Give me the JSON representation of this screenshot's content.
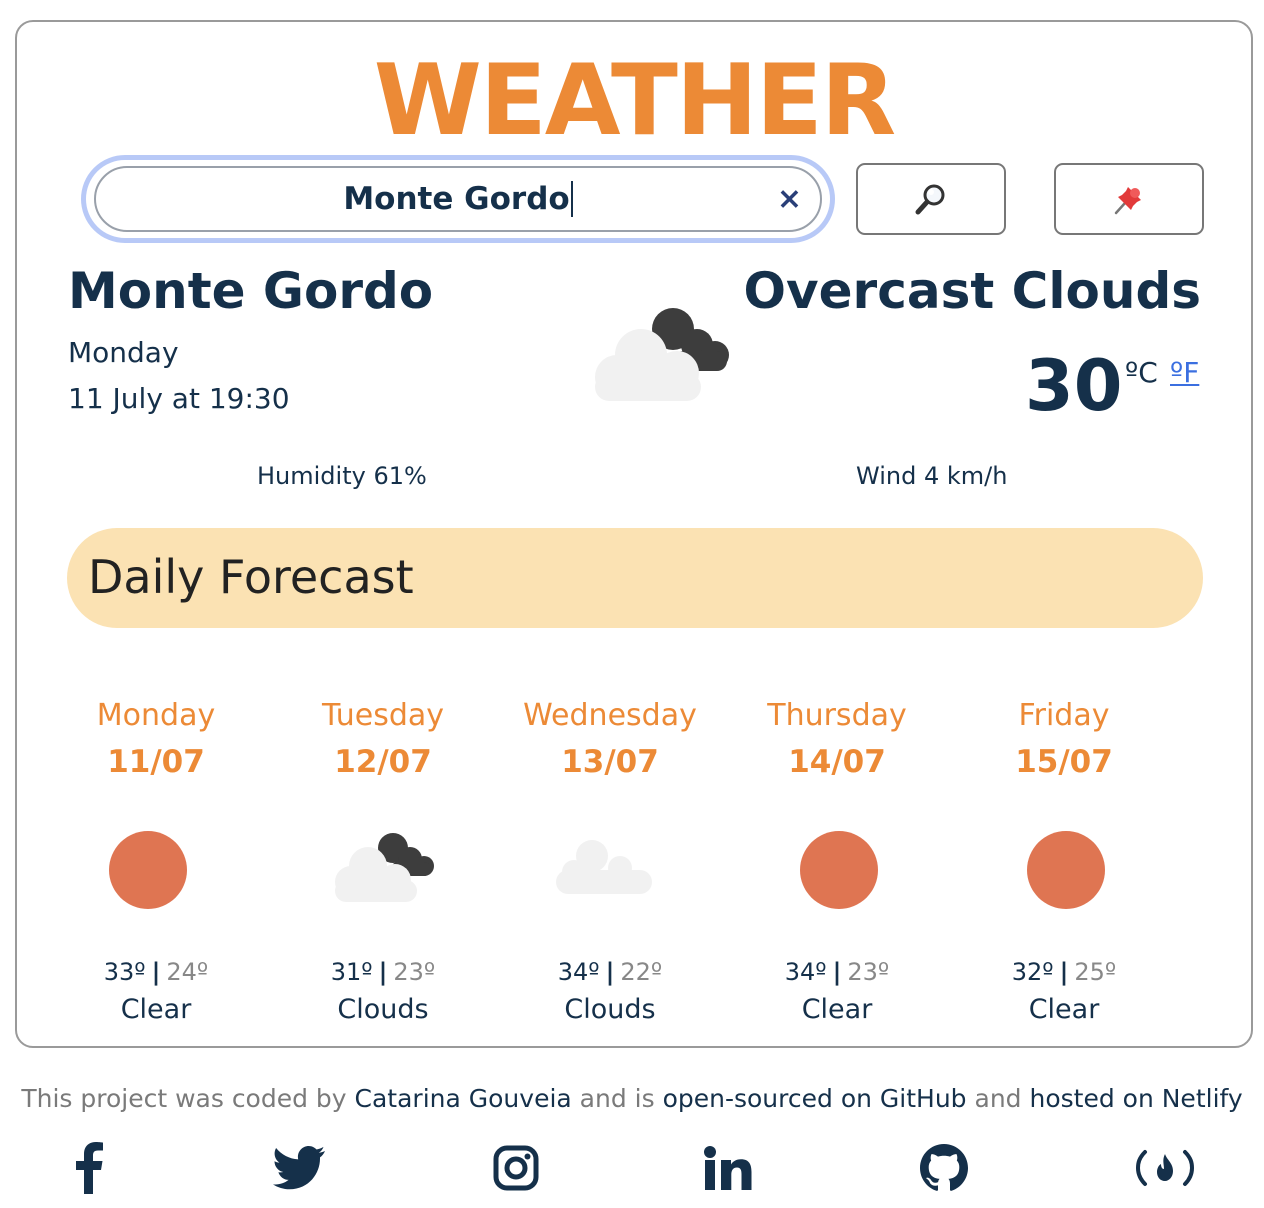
{
  "app": {
    "title": "WEATHER"
  },
  "search": {
    "value": "Monte Gordo",
    "clear_glyph": "×"
  },
  "buttons": {
    "search_icon": "magnifier-icon",
    "location_icon": "pushpin-icon"
  },
  "current": {
    "city": "Monte Gordo",
    "day": "Monday",
    "date": "11 July at 19:30",
    "condition": "Overcast Clouds",
    "temperature": "30",
    "unit_c": "ºC",
    "unit_f": "ºF",
    "humidity": "Humidity 61%",
    "wind": "Wind 4 km/h",
    "icon": "overcast-clouds-icon"
  },
  "forecast": {
    "title": "Daily Forecast",
    "days": [
      {
        "name": "Monday",
        "date": "11/07",
        "max": "33º",
        "min": "24º",
        "desc": "Clear",
        "icon": "sun"
      },
      {
        "name": "Tuesday",
        "date": "12/07",
        "max": "31º",
        "min": "23º",
        "desc": "Clouds",
        "icon": "dark-clouds"
      },
      {
        "name": "Wednesday",
        "date": "13/07",
        "max": "34º",
        "min": "22º",
        "desc": "Clouds",
        "icon": "cloud"
      },
      {
        "name": "Thursday",
        "date": "14/07",
        "max": "34º",
        "min": "23º",
        "desc": "Clear",
        "icon": "sun"
      },
      {
        "name": "Friday",
        "date": "15/07",
        "max": "32º",
        "min": "25º",
        "desc": "Clear",
        "icon": "sun"
      }
    ]
  },
  "footer": {
    "t1": "This project was coded by ",
    "author": "Catarina Gouveia",
    "t2": " and is ",
    "github": "open-sourced on GitHub",
    "t3": " and ",
    "netlify": "hosted on Netlify"
  },
  "colors": {
    "accent": "#ec8a36",
    "text": "#15304a",
    "banner": "#fbe2b3",
    "sun": "#df7552",
    "link": "#3b6fe0"
  },
  "social": [
    "facebook-icon",
    "twitter-icon",
    "instagram-icon",
    "linkedin-icon",
    "github-icon",
    "freecodecamp-icon"
  ]
}
